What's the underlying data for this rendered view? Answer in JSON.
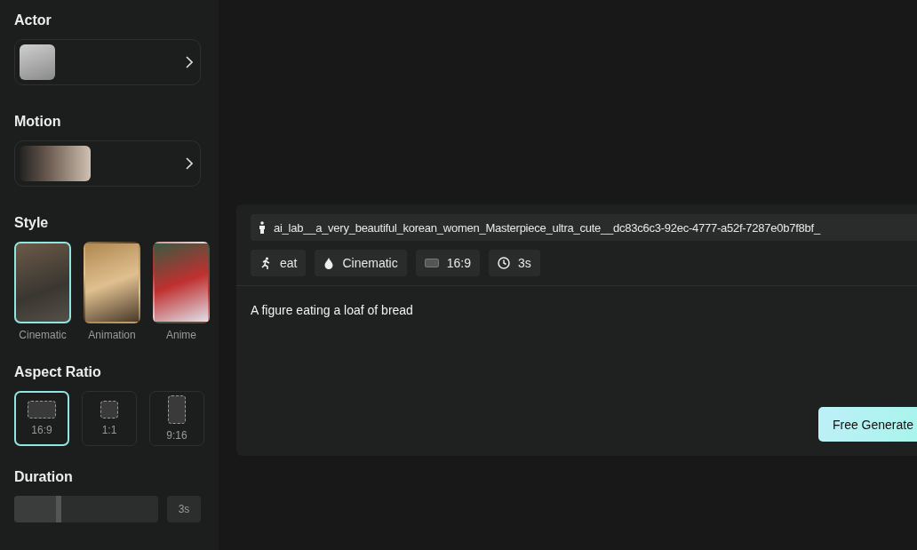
{
  "sidebar": {
    "actor": {
      "label": "Actor"
    },
    "motion": {
      "label": "Motion"
    },
    "style": {
      "label": "Style",
      "options": [
        {
          "label": "Cinematic",
          "selected": true
        },
        {
          "label": "Animation",
          "selected": false
        },
        {
          "label": "Anime",
          "selected": false
        }
      ]
    },
    "aspect_ratio": {
      "label": "Aspect Ratio",
      "options": [
        {
          "label": "16:9",
          "kind": "wide",
          "selected": true
        },
        {
          "label": "1:1",
          "kind": "square",
          "selected": false
        },
        {
          "label": "9:16",
          "kind": "tall",
          "selected": false
        }
      ]
    },
    "duration": {
      "label": "Duration",
      "level": 0.31,
      "value": "3s"
    }
  },
  "prompt_card": {
    "filename": "ai_lab__a_very_beautiful_korean_women_Masterpiece_ultra_cute__dc83c6c3-92ec-4777-a52f-7287e0b7f8bf_",
    "tags": [
      {
        "kind": "motion",
        "label": "eat"
      },
      {
        "kind": "style",
        "label": "Cinematic"
      },
      {
        "kind": "ratio",
        "label": "16:9"
      },
      {
        "kind": "duration",
        "label": "3s"
      }
    ],
    "prompt": "A figure eating a loaf of bread",
    "button": "Free Generate"
  }
}
